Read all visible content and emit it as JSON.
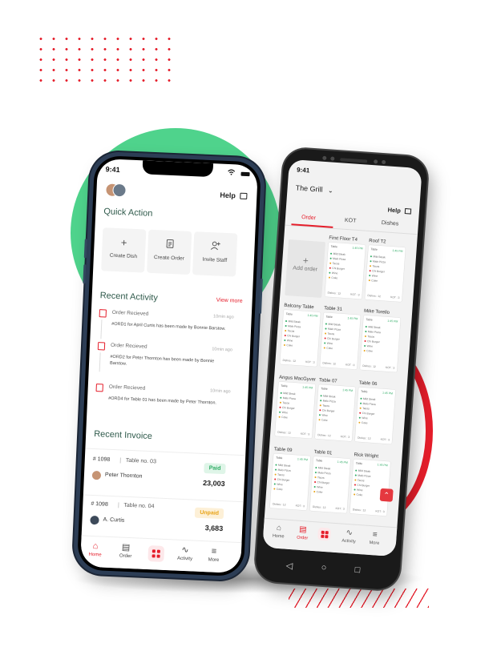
{
  "colors": {
    "accent": "#e51d2a",
    "green": "#4fd38c",
    "paid": "#2cab63",
    "unpaid": "#e8a317"
  },
  "phone1": {
    "status_time": "9:41",
    "help_label": "Help",
    "quick_action_title": "Quick Action",
    "quick_actions": [
      {
        "label": "Create Dish",
        "icon": "plus-icon"
      },
      {
        "label": "Create Order",
        "icon": "document-icon"
      },
      {
        "label": "Invite Staff",
        "icon": "add-user-icon"
      }
    ],
    "recent_activity_title": "Recent Activity",
    "view_more_label": "View more",
    "activities": [
      {
        "title": "Order Recieved",
        "time": "10min ago",
        "desc": "#ORD1 for April Curtis has been made by Bonnie Barstow."
      },
      {
        "title": "Order Recieved",
        "time": "10min ago",
        "desc": "#ORD2 for Peter Thornton has been made by Bonnie Barstow."
      },
      {
        "title": "Order Recieved",
        "time": "10min ago",
        "desc": "#ORD4 for Table 01 has been made by Peter Thornton."
      }
    ],
    "recent_invoice_title": "Recent Invoice",
    "invoices": [
      {
        "number": "# 1098",
        "table": "Table no. 03",
        "person": "Peter Thornton",
        "status": "Paid",
        "amount": "23,003"
      },
      {
        "number": "# 1098",
        "table": "Table no. 04",
        "person": "A. Curtis",
        "status": "Unpaid",
        "amount": "3,683"
      }
    ],
    "tabs": [
      "Home",
      "Order",
      "",
      "Activity",
      "More"
    ]
  },
  "phone2": {
    "status_time": "9:41",
    "restaurant": "The Grill",
    "help_label": "Help",
    "tabs": [
      "Order",
      "KOT",
      "Dishes"
    ],
    "add_order_label": "Add order",
    "tables": [
      {
        "name": "First Floor T4"
      },
      {
        "name": "Roof T2"
      },
      {
        "name": "Balcony Table"
      },
      {
        "name": "Table 31"
      },
      {
        "name": "Mike Torello"
      },
      {
        "name": "Angus MacGyver"
      },
      {
        "name": "Table 07"
      },
      {
        "name": "Table 06"
      },
      {
        "name": "Table 09"
      },
      {
        "name": "Table 01"
      },
      {
        "name": "Rick Wright"
      }
    ],
    "card_header": "Table",
    "card_time": "1:45 PM",
    "card_items": [
      "Mild Steak",
      "Malo Pizza",
      "Tacos",
      "Chi Burger",
      "Wine",
      "Coke"
    ],
    "card_footer_left": "Dishes : 12",
    "card_footer_right": "KOT : 3",
    "bottom_tabs": [
      "Home",
      "Order",
      "",
      "Activity",
      "More"
    ]
  }
}
